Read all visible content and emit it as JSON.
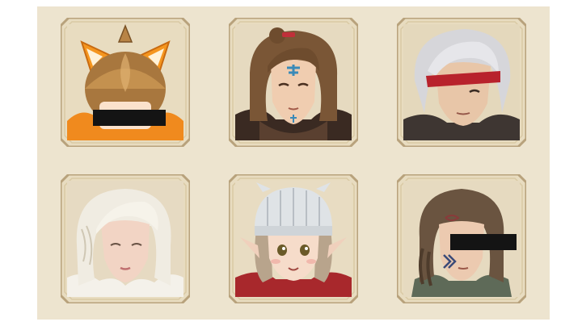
{
  "screen": {
    "title": "",
    "background": "#ede4cf"
  },
  "colors": {
    "card_fill": "#e8dcc0",
    "card_border": "#b8a27c",
    "card_inner": "#d9c9a4",
    "censor": "#141414"
  },
  "portraits": [
    {
      "name": "fox-helmet-mascot-portrait",
      "icon": "fox-helmet-icon",
      "censored": true
    },
    {
      "name": "brown-haired-tattooed-man-portrait",
      "icon": "face-tattoo-icon",
      "censored": false
    },
    {
      "name": "silver-haired-eyepatch-man-portrait",
      "icon": "eyepatch-icon",
      "censored": false
    },
    {
      "name": "platinum-braided-woman-portrait",
      "icon": "braid-icon",
      "censored": false
    },
    {
      "name": "knit-hat-elf-girl-portrait",
      "icon": "knit-hat-icon",
      "censored": false
    },
    {
      "name": "braided-tattooed-warrior-portrait",
      "icon": "face-tattoo-icon",
      "censored": true
    }
  ]
}
